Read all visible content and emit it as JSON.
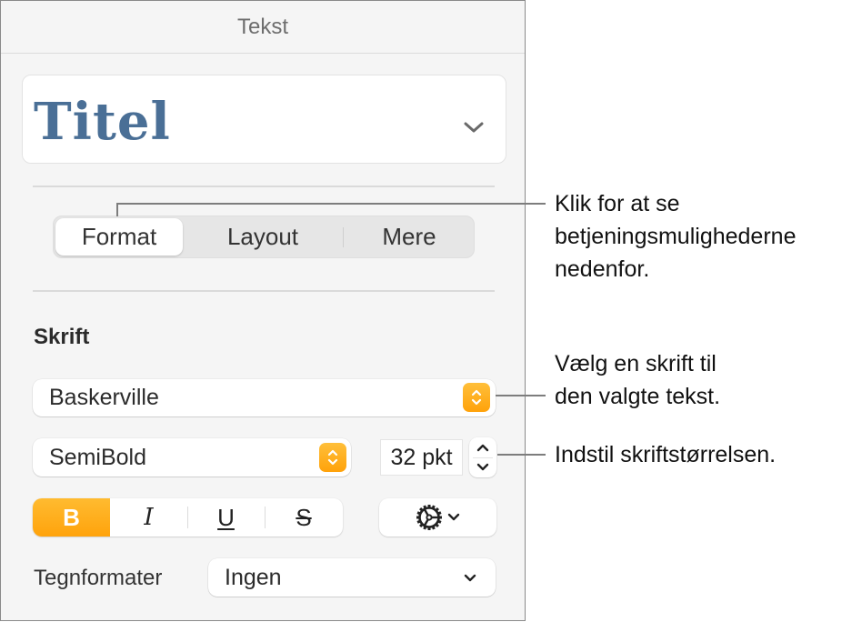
{
  "panel": {
    "title": "Tekst",
    "paragraph_style": {
      "name": "Titel",
      "color": "#4a6f96"
    },
    "tabs": [
      {
        "label": "Format",
        "active": true
      },
      {
        "label": "Layout",
        "active": false
      },
      {
        "label": "Mere",
        "active": false
      }
    ],
    "font_section": {
      "heading": "Skrift",
      "font_family": "Baskerville",
      "font_typeface": "SemiBold",
      "font_size": "32 pkt",
      "style_buttons": [
        {
          "label": "B",
          "name": "bold",
          "active": true
        },
        {
          "label": "I",
          "name": "italic",
          "active": false
        },
        {
          "label": "U",
          "name": "underline",
          "active": false
        },
        {
          "label": "S",
          "name": "strikethrough",
          "active": false
        }
      ],
      "advanced_options_icon": "gear-icon",
      "character_styles_label": "Tegnformater",
      "character_styles_value": "Ingen"
    },
    "accent_color": "#ffa812"
  },
  "callouts": [
    {
      "text": "Klik for at se\nbetjeningsmulighederne\nnedenfor."
    },
    {
      "text": "Vælg en skrift til\nden valgte tekst."
    },
    {
      "text": "Indstil skriftstørrelsen."
    }
  ]
}
